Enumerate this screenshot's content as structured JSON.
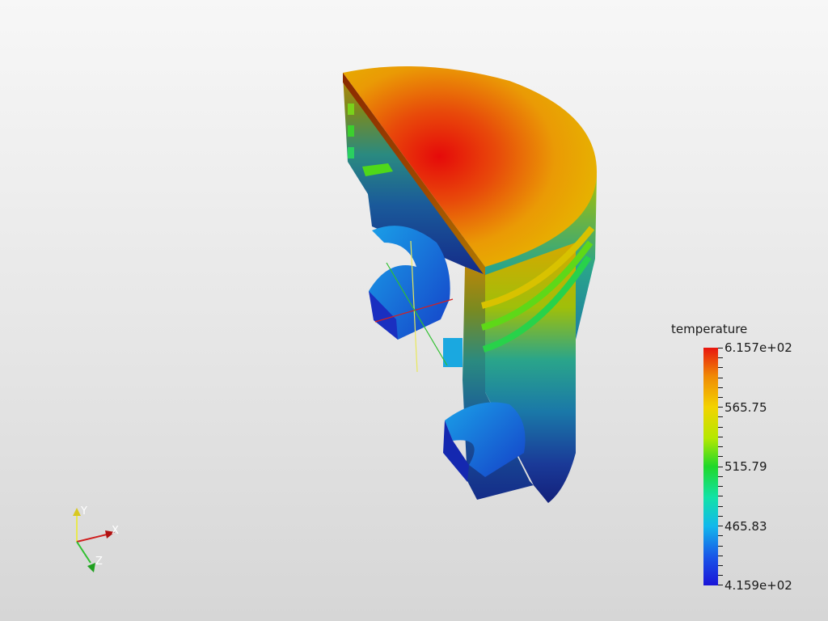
{
  "legend": {
    "title": "temperature",
    "labels": [
      "6.157e+02",
      "565.75",
      "515.79",
      "465.83",
      "4.159e+02"
    ]
  },
  "axes": {
    "x": "X",
    "y": "Y",
    "z": "Z"
  },
  "colors": {
    "max": "#e8160f",
    "high": "#f3d300",
    "mid": "#1fd82a",
    "low": "#12b8ec",
    "min": "#1a14d8"
  }
}
